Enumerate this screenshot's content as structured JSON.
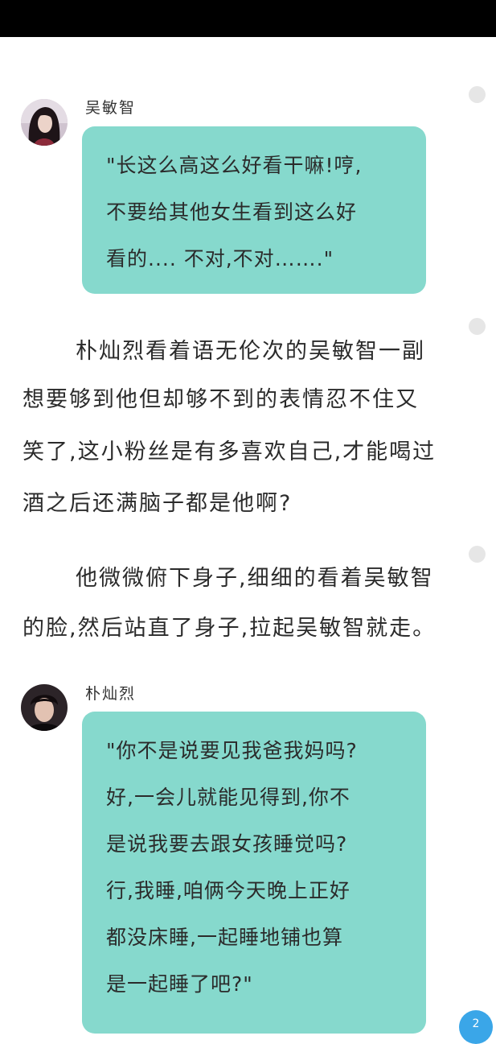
{
  "colors": {
    "bubble_bg": "#86d9cd",
    "page_badge_bg": "#3aa6e8"
  },
  "messages": [
    {
      "speaker": "吴敏智",
      "lines": [
        "\"长这么高这么好看干嘛!哼,",
        "不要给其他女生看到这么好",
        "看的....  不对,不对…….\""
      ]
    },
    {
      "speaker": "朴灿烈",
      "lines": [
        "\"你不是说要见我爸我妈吗?",
        "好,一会儿就能见得到,你不",
        "是说我要去跟女孩睡觉吗?",
        "行,我睡,咱俩今天晚上正好",
        "都没床睡,一起睡地铺也算",
        "是一起睡了吧?\""
      ]
    }
  ],
  "paragraphs": [
    {
      "lines": [
        "朴灿烈看着语无伦次的吴敏智一副",
        "想要够到他但却够不到的表情忍不住又",
        "笑了,这小粉丝是有多喜欢自己,才能喝过",
        "酒之后还满脑子都是他啊?"
      ]
    },
    {
      "lines": [
        "他微微俯下身子,细细的看着吴敏智",
        "的脸,然后站直了身子,拉起吴敏智就走。"
      ]
    }
  ],
  "page_badge": "2"
}
